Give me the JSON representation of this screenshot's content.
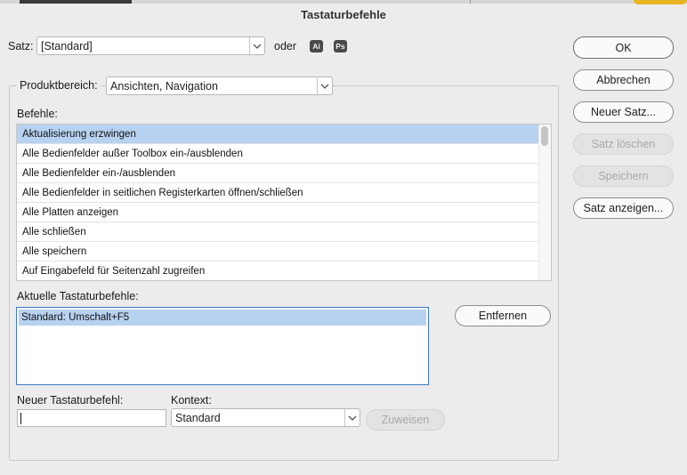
{
  "dialog": {
    "title": "Tastaturbefehle"
  },
  "set": {
    "label": "Satz:",
    "value": "[Standard]",
    "or_label": "oder",
    "app_badges": [
      "Ai",
      "Ps"
    ]
  },
  "product_area": {
    "label": "Produktbereich:",
    "value": "Ansichten, Navigation"
  },
  "commands": {
    "label": "Befehle:",
    "items": [
      "Aktualisierung erzwingen",
      "Alle Bedienfelder außer Toolbox ein-/ausblenden",
      "Alle Bedienfelder ein-/ausblenden",
      "Alle Bedienfelder in seitlichen Registerkarten öffnen/schließen",
      "Alle Platten anzeigen",
      "Alle schließen",
      "Alle speichern",
      "Auf Eingabefeld für Seitenzahl zugreifen"
    ],
    "selected_index": 0
  },
  "current_shortcuts": {
    "label": "Aktuelle Tastaturbefehle:",
    "items": [
      "Standard: Umschalt+F5"
    ],
    "remove_button": "Entfernen"
  },
  "new_shortcut": {
    "label": "Neuer Tastaturbefehl:",
    "value": ""
  },
  "context": {
    "label": "Kontext:",
    "value": "Standard"
  },
  "assign_button": "Zuweisen",
  "side_buttons": {
    "ok": "OK",
    "cancel": "Abbrechen",
    "new_set": "Neuer Satz...",
    "delete_set": "Satz löschen",
    "save": "Speichern",
    "show_set": "Satz anzeigen..."
  }
}
